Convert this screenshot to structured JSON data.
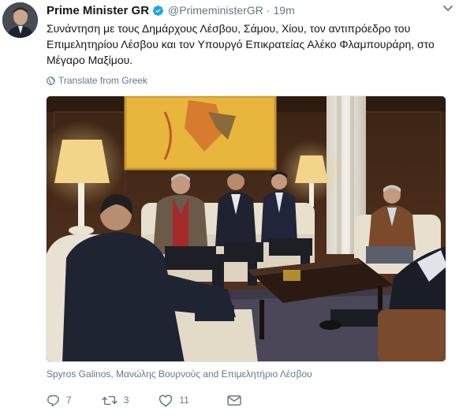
{
  "tweet": {
    "author_name": "Prime Minister GR",
    "handle": "@PrimeministerGR",
    "separator": "·",
    "time": "19m",
    "text": "Συνάντηση με τους Δημάρχους Λέσβου, Σάμου, Χίου, τον αντιπρόεδρο του Επιμελητηρίου Λέσβου και τον Υπουργό Επικρατείας Αλέκο Φλαμπουράρη, στο Μέγαρο Μαξίμου.",
    "translate_label": "Translate from Greek",
    "photo_tags": "Spyros Galinos, Μανώλης Βουρνούς and Επιμελητήριο Λέσβου"
  },
  "actions": {
    "reply_count": "7",
    "retweet_count": "3",
    "like_count": "11"
  },
  "icons": {
    "verified": "verified-badge-icon",
    "caret": "chevron-down-icon",
    "globe": "globe-icon",
    "reply": "reply-icon",
    "retweet": "retweet-icon",
    "like": "heart-icon",
    "message": "envelope-icon"
  },
  "colors": {
    "verified_blue": "#1da1f2",
    "secondary_text": "#657786",
    "primary_text": "#14171a"
  }
}
